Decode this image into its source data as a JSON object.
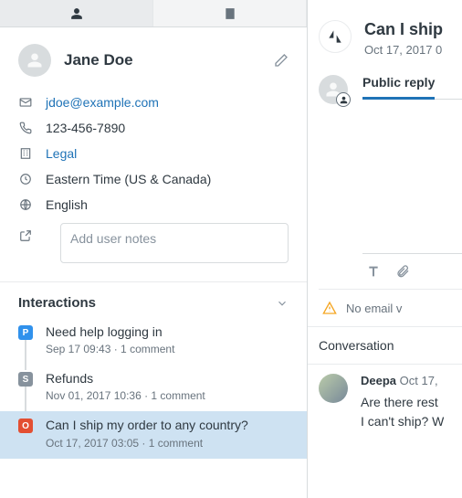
{
  "user": {
    "name": "Jane Doe",
    "email": "jdoe@example.com",
    "phone": "123-456-7890",
    "org": "Legal",
    "timezone": "Eastern Time (US & Canada)",
    "language": "English",
    "notes_placeholder": "Add user notes"
  },
  "interactions": {
    "heading": "Interactions",
    "items": [
      {
        "badge": "P",
        "title": "Need help logging in",
        "meta": "Sep 17 09:43 · 1 comment"
      },
      {
        "badge": "S",
        "title": "Refunds",
        "meta": "Nov 01, 2017 10:36 · 1 comment"
      },
      {
        "badge": "O",
        "title": "Can I ship my order to any country?",
        "meta": "Oct 17, 2017 03:05 · 1 comment"
      }
    ]
  },
  "ticket": {
    "title": "Can I ship",
    "meta": "Oct 17, 2017 0",
    "reply_tab": "Public reply",
    "warning": "No email v",
    "conversation_label": "Conversation"
  },
  "message": {
    "author": "Deepa",
    "time": "Oct 17,",
    "line1": "Are there rest",
    "line2": "I can't ship? W"
  }
}
